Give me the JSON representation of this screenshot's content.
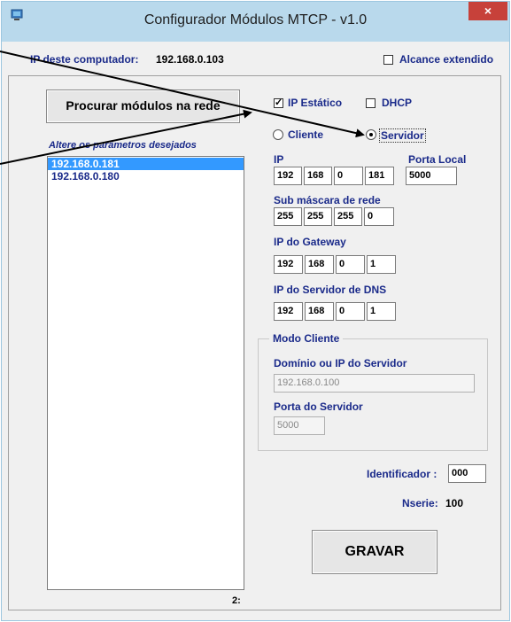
{
  "window": {
    "title": "Configurador Módulos MTCP - v1.0",
    "close_glyph": "×",
    "app_icon": "monitor-icon"
  },
  "header": {
    "ip_label": "IP deste computador:",
    "ip_value": "192.168.0.103",
    "extended_range_label": "Alcance extendido",
    "extended_range_checked": false
  },
  "search_button_label": "Procurar módulos na rede",
  "list": {
    "hint": "Altere os parâmetros desejados",
    "items": [
      "192.168.0.181",
      "192.168.0.180"
    ],
    "selected_index": 0,
    "count_label": "2:"
  },
  "mode": {
    "static_ip_label": "IP Estático",
    "static_ip_checked": true,
    "dhcp_label": "DHCP",
    "dhcp_checked": false,
    "client_label": "Cliente",
    "server_label": "Servidor",
    "selected": "Servidor"
  },
  "network": {
    "ip_label": "IP",
    "ip": [
      "192",
      "168",
      "0",
      "181"
    ],
    "port_label": "Porta Local",
    "port": "5000",
    "mask_label": "Sub máscara de rede",
    "mask": [
      "255",
      "255",
      "255",
      "0"
    ],
    "gateway_label": "IP do Gateway",
    "gateway": [
      "192",
      "168",
      "0",
      "1"
    ],
    "dns_label": "IP do Servidor de DNS",
    "dns": [
      "192",
      "168",
      "0",
      "1"
    ]
  },
  "client_mode": {
    "group_title": "Modo Cliente",
    "server_domain_label": "Domínio ou IP do Servidor",
    "server_domain": "192.168.0.100",
    "server_port_label": "Porta do Servidor",
    "server_port": "5000"
  },
  "identifier": {
    "label": "Identificador :",
    "value": "000"
  },
  "serial": {
    "label": "Nserie:",
    "value": "100"
  },
  "save_button_label": "GRAVAR",
  "colors": {
    "title_bar": "#b9d9ec",
    "label_blue": "#1a2a8a",
    "selection": "#3399ff",
    "close": "#c7413a"
  }
}
